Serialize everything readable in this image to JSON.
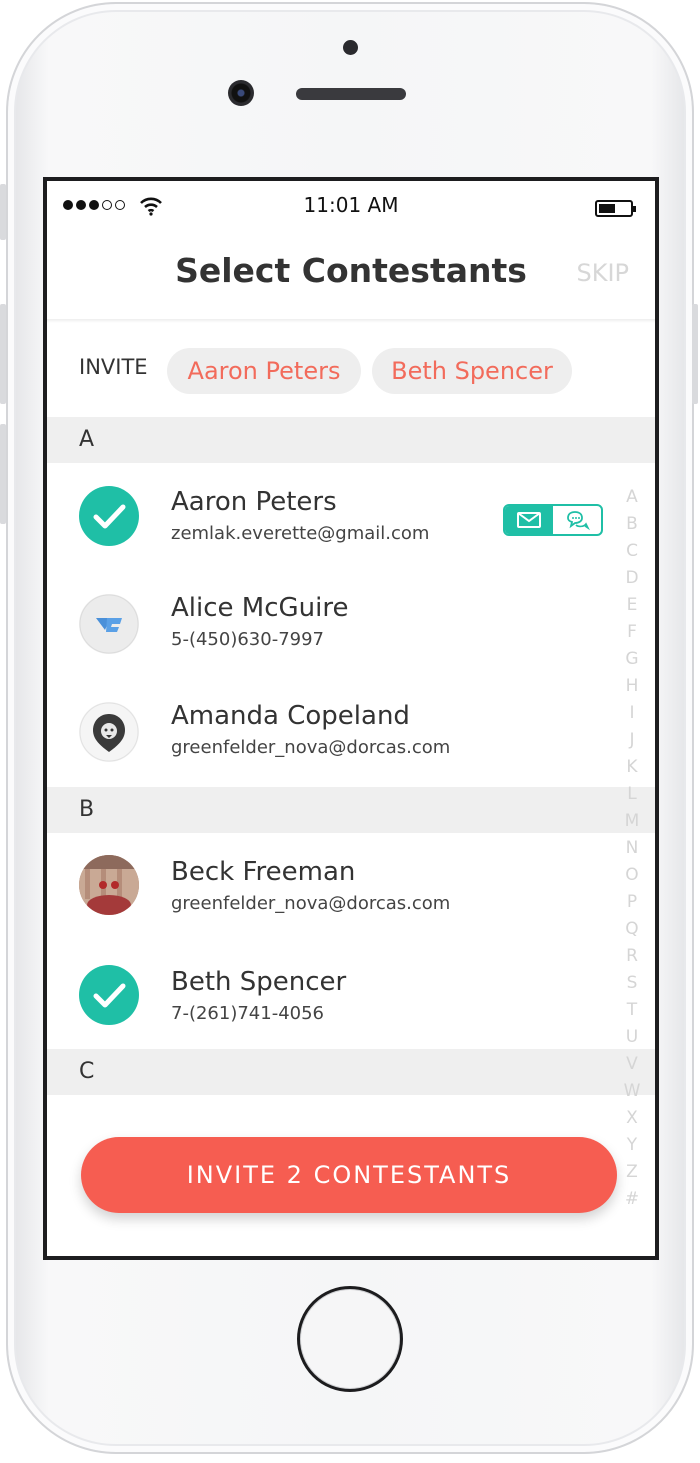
{
  "status_bar": {
    "time": "11:01 AM",
    "signal_bars": 3,
    "signal_total": 5
  },
  "header": {
    "title": "Select Contestants",
    "skip_label": "SKIP"
  },
  "invite": {
    "label": "INVITE",
    "chips": [
      "Aaron Peters",
      "Beth Spencer"
    ]
  },
  "sections": [
    {
      "letter": "A",
      "contacts": [
        {
          "name": "Aaron Peters",
          "detail": "zemlak.everette@gmail.com",
          "selected": true
        },
        {
          "name": "Alice McGuire",
          "detail": "5-(450)630-7997",
          "selected": false
        },
        {
          "name": "Amanda Copeland",
          "detail": "greenfelder_nova@dorcas.com",
          "selected": false
        }
      ]
    },
    {
      "letter": "B",
      "contacts": [
        {
          "name": "Beck Freeman",
          "detail": "greenfelder_nova@dorcas.com",
          "selected": false
        },
        {
          "name": "Beth Spencer",
          "detail": "7-(261)741-4056",
          "selected": true
        }
      ]
    },
    {
      "letter": "C",
      "contacts": []
    }
  ],
  "index_letters": [
    "A",
    "B",
    "C",
    "D",
    "E",
    "F",
    "G",
    "H",
    "I",
    "J",
    "K",
    "L",
    "M",
    "N",
    "O",
    "P",
    "Q",
    "R",
    "S",
    "T",
    "U",
    "V",
    "W",
    "X",
    "Y",
    "Z",
    "#"
  ],
  "cta_label": "INVITE 2 CONTESTANTS",
  "colors": {
    "accent": "#1fbfa6",
    "brand": "#f65d51",
    "chip_text": "#f26b5b"
  },
  "icons": {
    "selected": "check-icon",
    "email": "mail-icon",
    "message": "chat-icon"
  }
}
